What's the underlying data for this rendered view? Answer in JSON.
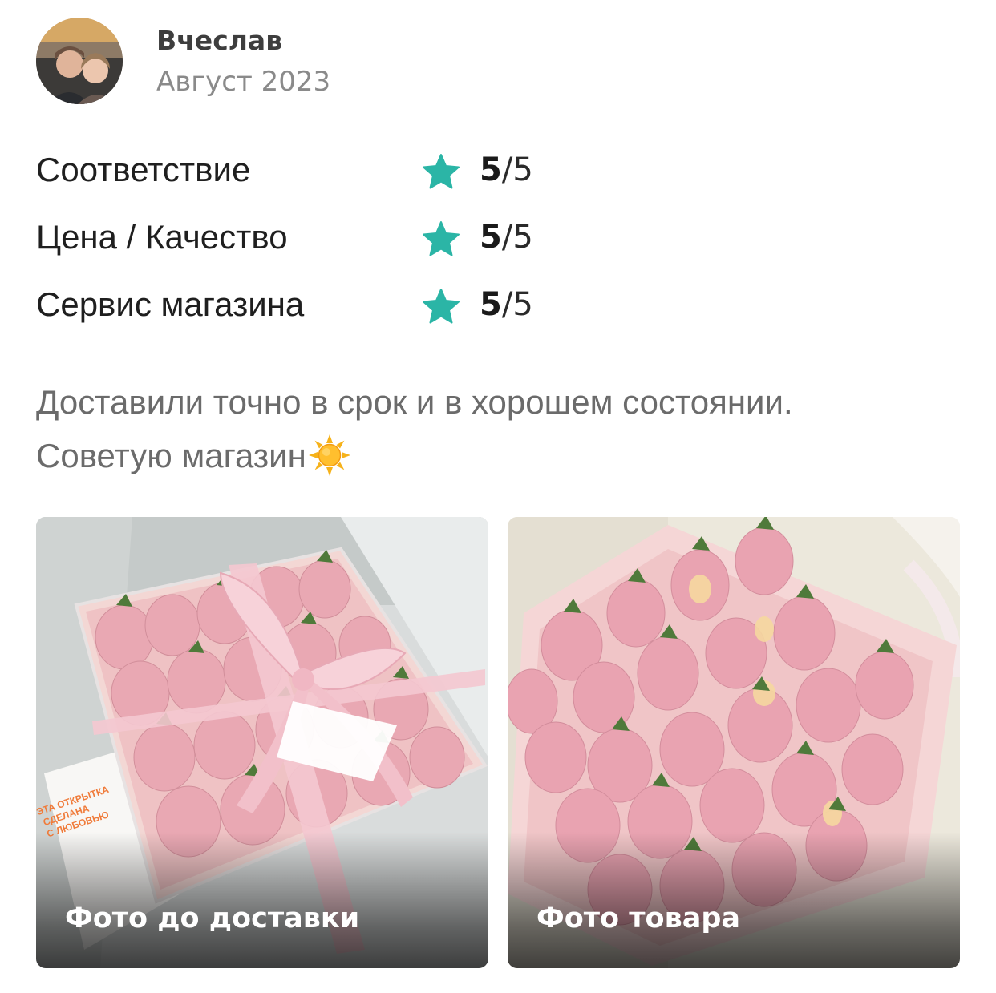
{
  "review": {
    "author_name": "Вчеслав",
    "date": "Август 2023",
    "avatar_icon": "user-avatar-photo",
    "text_line1": "Доставили точно в срок и в хорошем состоянии.",
    "text_line2": "Советую магазин",
    "emoji_icon": "sun-icon"
  },
  "ratings": [
    {
      "label": "Соответствие",
      "score": "5",
      "max": "/5",
      "icon": "star-icon"
    },
    {
      "label": "Цена / Качество",
      "score": "5",
      "max": "/5",
      "icon": "star-icon"
    },
    {
      "label": "Сервис магазина",
      "score": "5",
      "max": "/5",
      "icon": "star-icon"
    }
  ],
  "photos": [
    {
      "caption": "Фото до доставки",
      "card_text": "ЭТА ОТКРЫТКА СДЕЛАНА С ЛЮБОВЬЮ"
    },
    {
      "caption": "Фото товара"
    }
  ],
  "colors": {
    "star": "#2bb5a6",
    "text_primary": "#1f1f1f",
    "text_muted": "#6b6b6b",
    "date": "#8a8a8a",
    "berry_pink": "#e8a2b0",
    "ribbon_pink": "#f2c4cc"
  }
}
